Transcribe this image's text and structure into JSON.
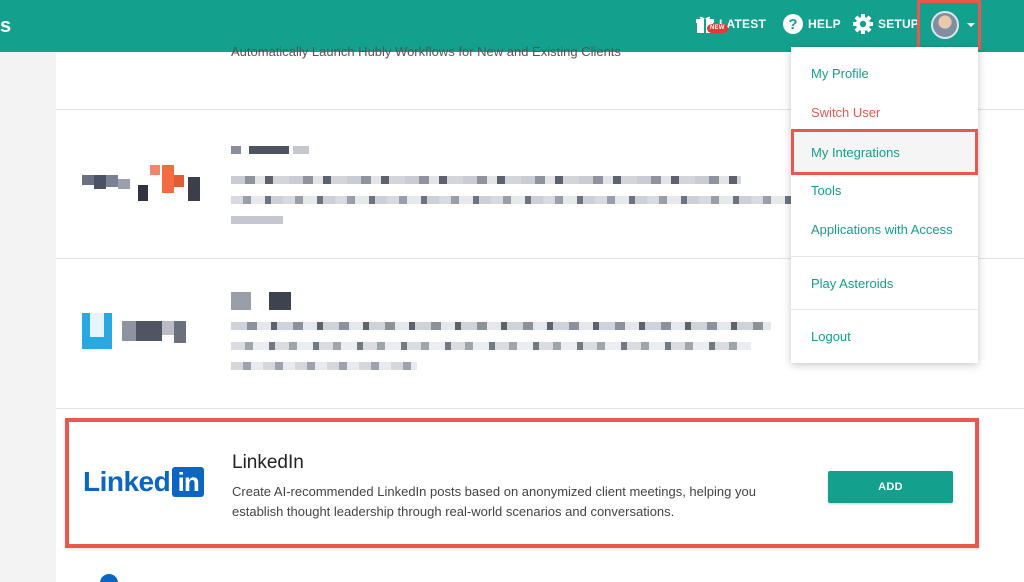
{
  "header": {
    "brand_fragment": "s",
    "nav": {
      "latest_label": "LATEST",
      "latest_badge": "NEW",
      "help_label": "HELP",
      "setup_label": "SETUP"
    }
  },
  "content": {
    "cut_text": "Automatically Launch Hubly Workflows for New and Existing Clients"
  },
  "linkedin_card": {
    "logo_text": "Linked",
    "logo_box": "in",
    "title": "LinkedIn",
    "description": "Create AI-recommended LinkedIn posts based on anonymized client meetings, helping you establish thought leadership through real-world scenarios and conversations.",
    "add_label": "ADD"
  },
  "user_menu": {
    "items": [
      {
        "label": "My Profile"
      },
      {
        "label": "Switch User"
      },
      {
        "label": "My Integrations"
      },
      {
        "label": "Tools"
      },
      {
        "label": "Applications with Access"
      },
      {
        "label": "Play Asteroids"
      },
      {
        "label": "Logout"
      }
    ]
  },
  "colors": {
    "brand": "#13a08d",
    "highlight": "#e8584f",
    "linkedin": "#0a66c2"
  }
}
